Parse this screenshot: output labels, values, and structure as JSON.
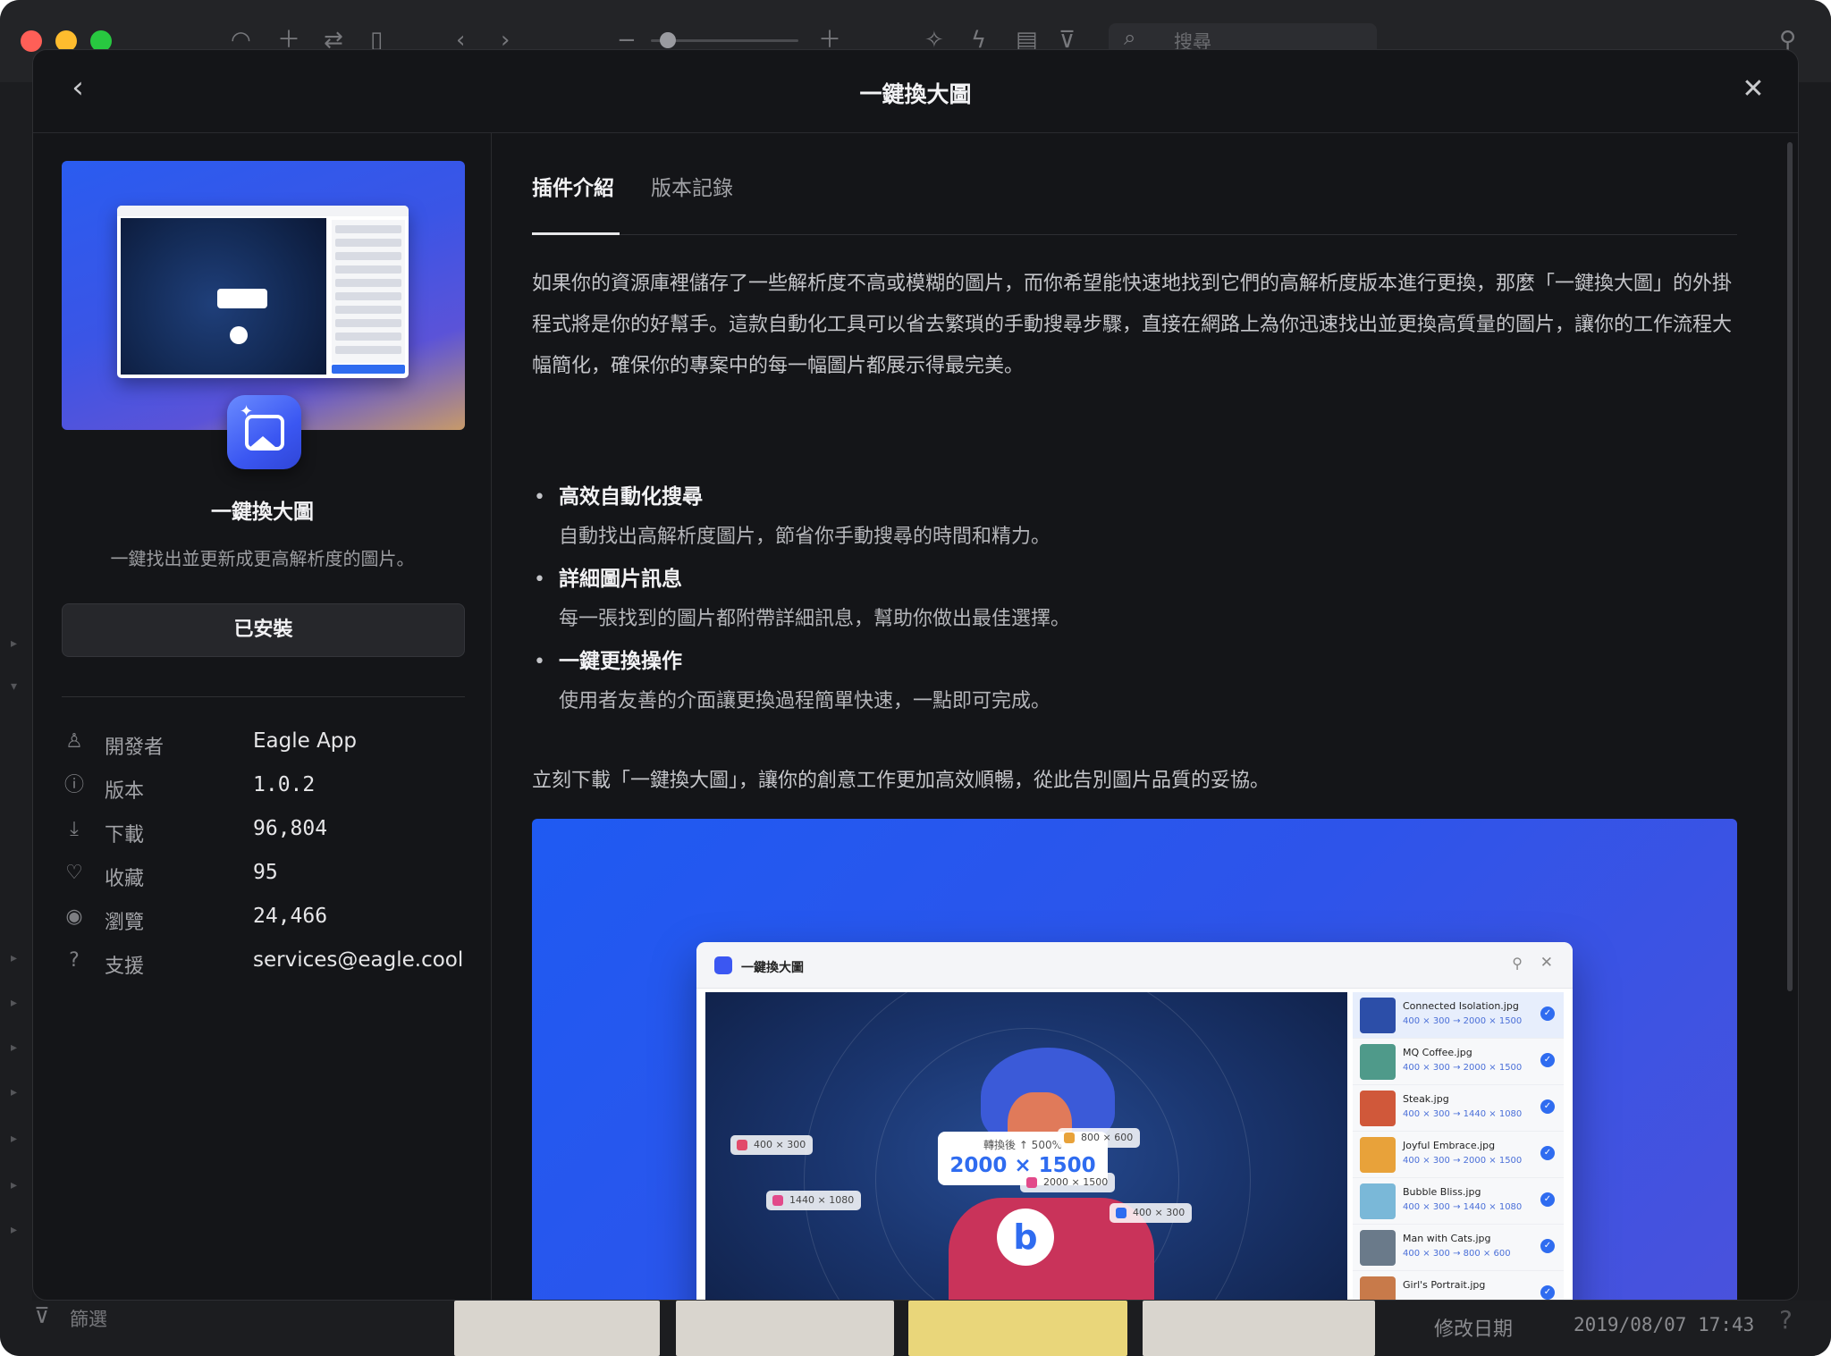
{
  "toolbar": {
    "search_placeholder": "搜尋"
  },
  "bottom_bar": {
    "filter_label": "篩選",
    "modified_label": "修改日期",
    "modified_value": "2019/08/07 17:43"
  },
  "dialog": {
    "title": "一鍵換大圖"
  },
  "plugin": {
    "name": "一鍵換大圖",
    "tagline": "一鍵找出並更新成更高解析度的圖片。",
    "install_status": "已安裝",
    "info": [
      {
        "icon": "user-icon",
        "label": "開發者",
        "value": "Eagle App"
      },
      {
        "icon": "info-icon",
        "label": "版本",
        "value": "1.0.2"
      },
      {
        "icon": "download-icon",
        "label": "下載",
        "value": "96,804"
      },
      {
        "icon": "heart-icon",
        "label": "收藏",
        "value": "95"
      },
      {
        "icon": "eye-icon",
        "label": "瀏覽",
        "value": "24,466"
      },
      {
        "icon": "help-icon",
        "label": "支援",
        "value": "services@eagle.cool"
      }
    ]
  },
  "tabs": [
    {
      "label": "插件介紹",
      "active": true
    },
    {
      "label": "版本記錄",
      "active": false
    }
  ],
  "content": {
    "intro": "如果你的資源庫裡儲存了一些解析度不高或模糊的圖片，而你希望能快速地找到它們的高解析度版本進行更換，那麼「一鍵換大圖」的外掛程式將是你的好幫手。這款自動化工具可以省去繁瑣的手動搜尋步驟，直接在網路上為你迅速找出並更換高質量的圖片，讓你的工作流程大幅簡化，確保你的專案中的每一幅圖片都展示得最完美。",
    "features": [
      {
        "title": "高效自動化搜尋",
        "desc": "自動找出高解析度圖片，節省你手動搜尋的時間和精力。"
      },
      {
        "title": "詳細圖片訊息",
        "desc": "每一張找到的圖片都附帶詳細訊息，幫助你做出最佳選擇。"
      },
      {
        "title": "一鍵更換操作",
        "desc": "使用者友善的介面讓更換過程簡單快速，一點即可完成。"
      }
    ],
    "cta": "立刻下載「一鍵換大圖」，讓你的創意工作更加高效順暢，從此告別圖片品質的妥協。"
  },
  "preview": {
    "window_title": "一鍵換大圖",
    "info_label": "轉換後 ↑ 500%",
    "info_size": "2000 × 1500",
    "chips": [
      "400 × 300",
      "800 × 600",
      "2000 × 1500",
      "1440 × 1080",
      "400 × 300"
    ],
    "items": [
      {
        "name": "Connected Isolation.jpg",
        "size": "400 × 300 → 2000 × 1500",
        "color": "#2c4ea8"
      },
      {
        "name": "MQ Coffee.jpg",
        "size": "400 × 300 → 2000 × 1500",
        "color": "#4f9a8a"
      },
      {
        "name": "Steak.jpg",
        "size": "400 × 300 → 1440 × 1080",
        "color": "#d0583a"
      },
      {
        "name": "Joyful Embrace.jpg",
        "size": "400 × 300 → 2000 × 1500",
        "color": "#e8a23a"
      },
      {
        "name": "Bubble Bliss.jpg",
        "size": "400 × 300 → 1440 × 1080",
        "color": "#7ab8d8"
      },
      {
        "name": "Man with Cats.jpg",
        "size": "400 × 300 → 800 × 600",
        "color": "#6a7a8a"
      },
      {
        "name": "Girl's Portrait.jpg",
        "size": "",
        "color": "#c87a4a"
      }
    ]
  }
}
